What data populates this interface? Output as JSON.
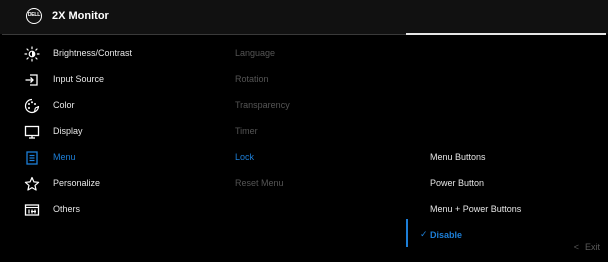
{
  "header": {
    "logo_text": "DELL",
    "title": "2X Monitor"
  },
  "left_menu": [
    {
      "label": "Brightness/Contrast",
      "icon": "brightness-icon"
    },
    {
      "label": "Input Source",
      "icon": "input-source-icon"
    },
    {
      "label": "Color",
      "icon": "color-icon"
    },
    {
      "label": "Display",
      "icon": "display-icon"
    },
    {
      "label": "Menu",
      "icon": "menu-icon"
    },
    {
      "label": "Personalize",
      "icon": "star-icon"
    },
    {
      "label": "Others",
      "icon": "others-icon"
    }
  ],
  "mid_menu": [
    {
      "label": "Language"
    },
    {
      "label": "Rotation"
    },
    {
      "label": "Transparency"
    },
    {
      "label": "Timer"
    },
    {
      "label": "Lock"
    },
    {
      "label": "Reset Menu"
    }
  ],
  "right_menu": [
    {
      "label": "Menu Buttons"
    },
    {
      "label": "Power Button"
    },
    {
      "label": "Menu + Power Buttons"
    },
    {
      "label": "Disable",
      "check": "✓"
    }
  ],
  "footer": {
    "exit_label": "Exit",
    "chevron": "<"
  },
  "colors": {
    "accent": "#1d7fd8",
    "background": "#000000",
    "header": "#111111"
  }
}
